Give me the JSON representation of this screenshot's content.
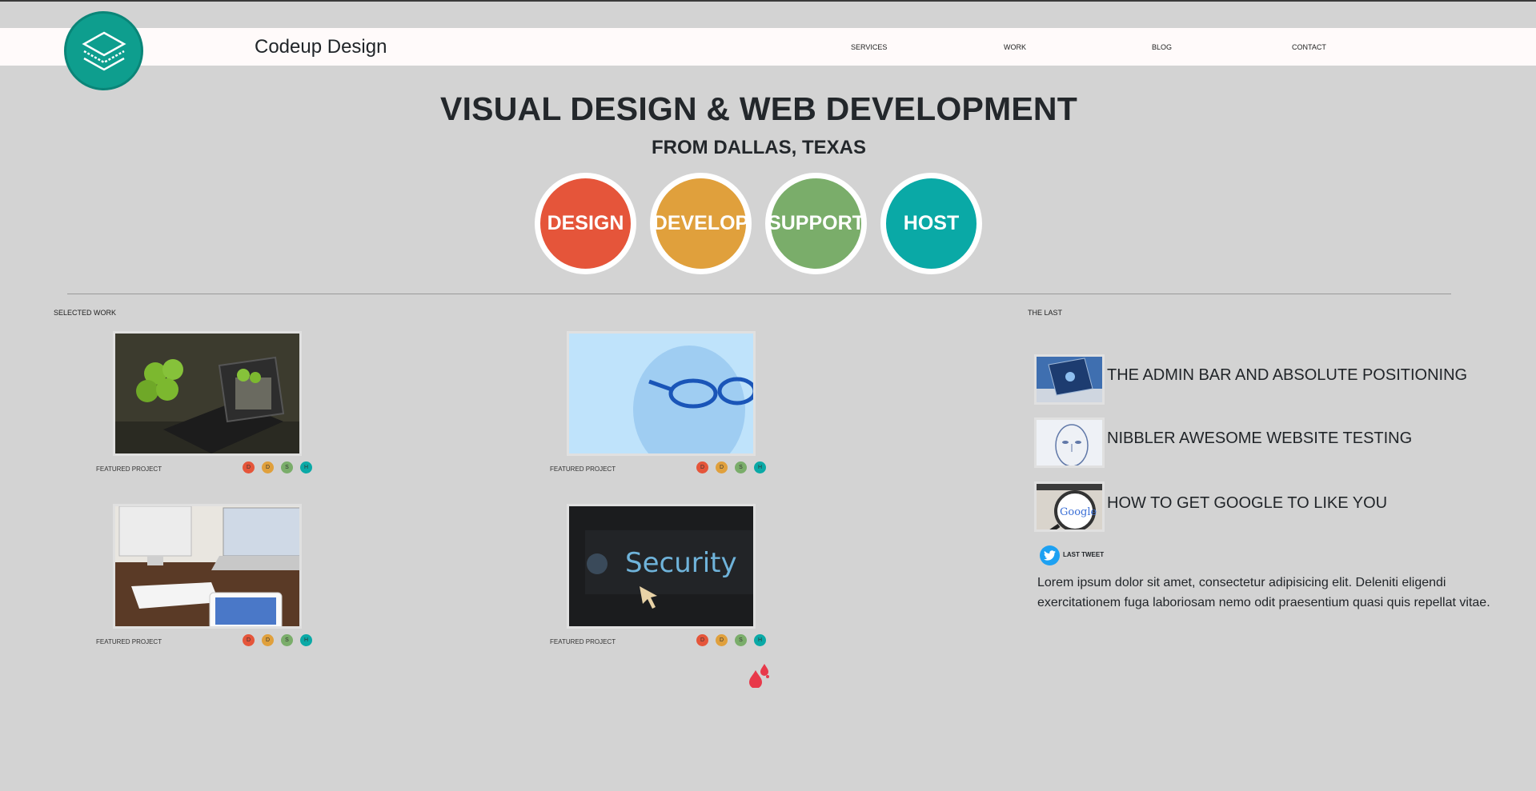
{
  "brand": {
    "name": "Codeup Design"
  },
  "nav": {
    "items": [
      "SERVICES",
      "WORK",
      "BLOG",
      "CONTACT"
    ]
  },
  "hero": {
    "title": "VISUAL DESIGN & WEB DEVELOPMENT",
    "subtitle": "FROM DALLAS, TEXAS"
  },
  "services": [
    {
      "label": "DESIGN",
      "color": "#e5553a"
    },
    {
      "label": "DEVELOP",
      "color": "#e0a03c"
    },
    {
      "label": "SUPPORT",
      "color": "#7aad6a"
    },
    {
      "label": "HOST",
      "color": "#0aa9a6"
    }
  ],
  "work": {
    "heading": "SELECTED WORK",
    "projects": [
      {
        "caption": "FEATURED PROJECT",
        "image": "apples-keyboard-tablet"
      },
      {
        "caption": "FEATURED PROJECT",
        "image": "binary-face-glasses"
      },
      {
        "caption": "FEATURED PROJECT",
        "image": "desk-computers"
      },
      {
        "caption": "FEATURED PROJECT",
        "image": "security-screen"
      }
    ],
    "tags": [
      {
        "letter": "D",
        "color": "#e5553a"
      },
      {
        "letter": "D",
        "color": "#e0a03c"
      },
      {
        "letter": "S",
        "color": "#7aad6a"
      },
      {
        "letter": "H",
        "color": "#0aa9a6"
      }
    ]
  },
  "blog": {
    "heading": "THE LAST",
    "posts": [
      {
        "title": "THE ADMIN BAR AND ABSOLUTE POSITIONING",
        "image": "phone-network"
      },
      {
        "title": "NIBBLER AWESOME WEBSITE TESTING",
        "image": "sketch-face"
      },
      {
        "title": "HOW TO GET GOOGLE TO LIKE YOU",
        "image": "google-magnifier"
      }
    ]
  },
  "tweet": {
    "label": "LAST TWEET",
    "text": "Lorem ipsum dolor sit amet, consectetur adipisicing elit. Deleniti eligendi exercitationem fuga laboriosam nemo odit praesentium quasi quis repellat vitae."
  }
}
